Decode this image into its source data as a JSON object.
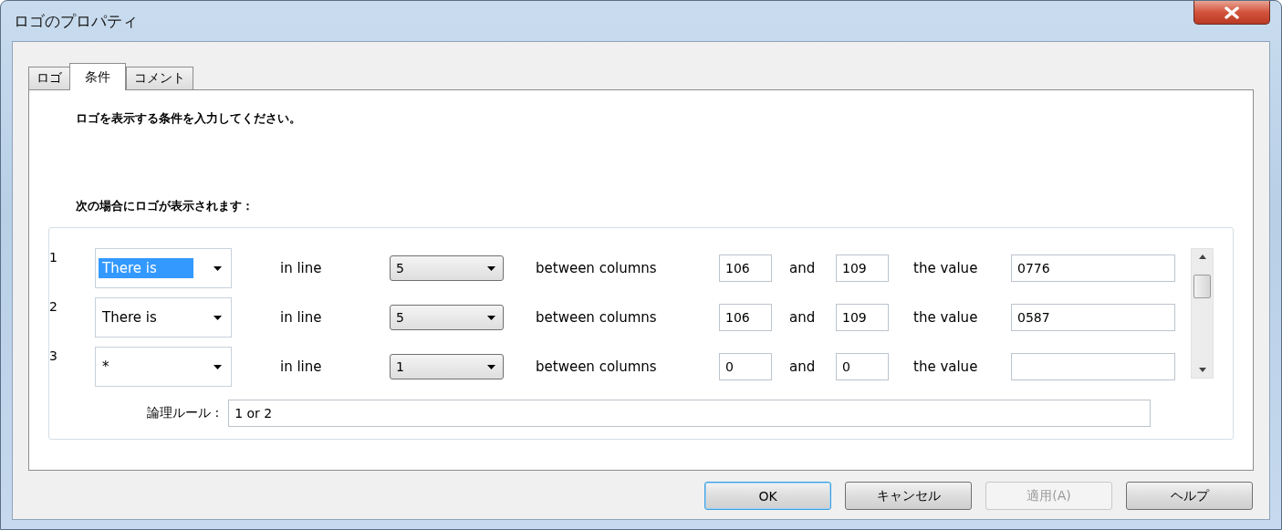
{
  "window": {
    "title": "ロゴのプロパティ"
  },
  "tabs": [
    {
      "label": "ロゴ",
      "selected": false
    },
    {
      "label": "条件",
      "selected": true
    },
    {
      "label": "コメント",
      "selected": false
    }
  ],
  "panel": {
    "instruction": "ロゴを表示する条件を入力してください。",
    "heading": "次の場合にロゴが表示されます：",
    "conditions": [
      {
        "number": "1",
        "operator": "There is",
        "highlighted": true,
        "in_line_label": "in line",
        "line": "5",
        "between_label": "between columns",
        "from_column": "106",
        "and_label": "and",
        "to_column": "109",
        "value_label": "the value",
        "value": "0776"
      },
      {
        "number": "2",
        "operator": "There is",
        "highlighted": false,
        "in_line_label": "in line",
        "line": "5",
        "between_label": "between columns",
        "from_column": "106",
        "and_label": "and",
        "to_column": "109",
        "value_label": "the value",
        "value": "0587"
      },
      {
        "number": "3",
        "operator": "*",
        "highlighted": false,
        "in_line_label": "in line",
        "line": "1",
        "between_label": "between columns",
        "from_column": "0",
        "and_label": "and",
        "to_column": "0",
        "value_label": "the value"
      }
    ],
    "logic_rule": {
      "label": "論理ルール :",
      "value": "1 or 2"
    }
  },
  "buttons": [
    {
      "label": "OK",
      "default": true,
      "disabled": false
    },
    {
      "label": "キャンセル",
      "default": false,
      "disabled": false
    },
    {
      "label": "適用(A)",
      "default": false,
      "disabled": true
    },
    {
      "label": "ヘルプ",
      "default": false,
      "disabled": false
    }
  ]
}
